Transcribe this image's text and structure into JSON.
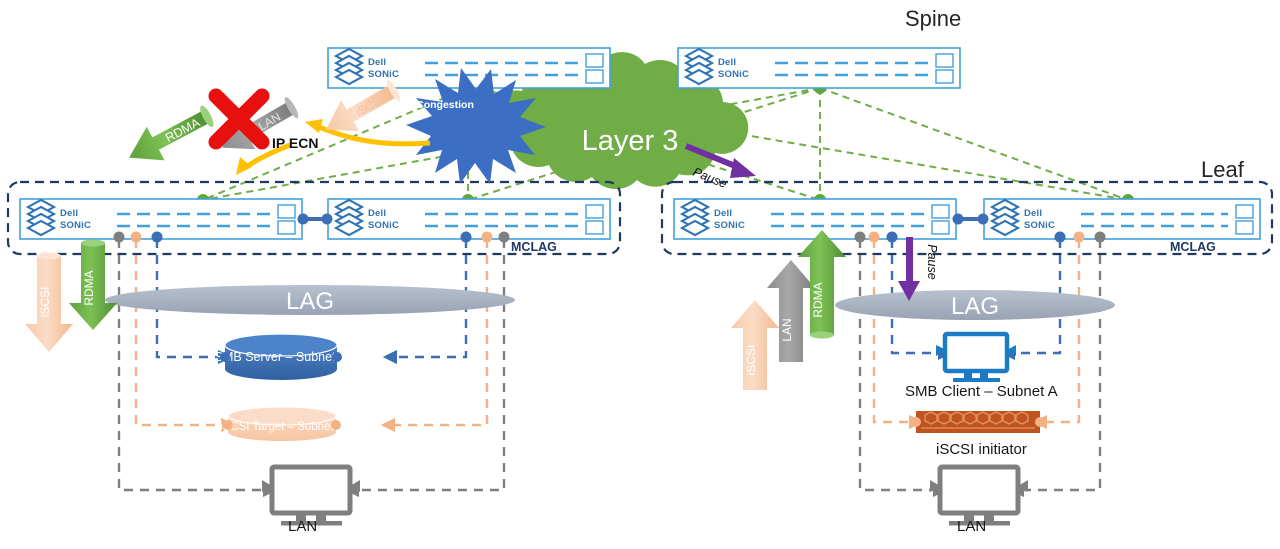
{
  "diagram": {
    "title_spine": "Spine",
    "title_leaf": "Leaf",
    "cloud_label": "Layer 3",
    "congestion_label": "Congestion",
    "ip_ecn_label": "IP ECN"
  },
  "colors": {
    "dell_blue": "#2e74b5",
    "switch_border": "#41a0dc",
    "leaf_box": "#1f3864",
    "cloud_green": "#70ad47",
    "rdma_green": "#5ea83c",
    "iscsi_peach": "#f8cbad",
    "lan_gray": "#808080",
    "pause_purple": "#7030a0",
    "congestion_blue": "#3c6fc4",
    "ecn_yellow": "#ffc000",
    "red_x": "#e8100f",
    "lag_gray": "#a6b1c2",
    "smb_blue": "#3b6eb5",
    "iscsi_init_orange": "#c0541f",
    "dot_gray": "#7f7f7f",
    "dot_peach": "#f4b183",
    "dot_blue": "#3b6eb5",
    "dot_green": "#5ea83c"
  },
  "switches": [
    {
      "id": "spine-1",
      "vendor": "Dell",
      "os": "SONiC",
      "role": "spine"
    },
    {
      "id": "spine-2",
      "vendor": "Dell",
      "os": "SONiC",
      "role": "spine"
    },
    {
      "id": "leaf-1",
      "vendor": "Dell",
      "os": "SONiC",
      "role": "leaf"
    },
    {
      "id": "leaf-2",
      "vendor": "Dell",
      "os": "SONiC",
      "role": "leaf"
    },
    {
      "id": "leaf-3",
      "vendor": "Dell",
      "os": "SONiC",
      "role": "leaf"
    },
    {
      "id": "leaf-4",
      "vendor": "Dell",
      "os": "SONiC",
      "role": "leaf"
    }
  ],
  "groups": {
    "left_mclag": "MCLAG",
    "right_mclag": "MCLAG",
    "left_lag": "LAG",
    "right_lag": "LAG"
  },
  "nodes": {
    "smb_server": "SMB Server – Subnet  B",
    "iscsi_target": "iSCSI Target – Subnet  A",
    "smb_client": "SMB Client – Subnet A",
    "iscsi_initiator": "iSCSI initiator",
    "lan_left": "LAN",
    "lan_right": "LAN"
  },
  "traffic_arrows": {
    "left_down": [
      {
        "label": "iSCSI",
        "color": "peach",
        "direction": "down"
      },
      {
        "label": "RDMA",
        "color": "green",
        "direction": "down"
      }
    ],
    "right_up": [
      {
        "label": "iSCSI",
        "color": "peach",
        "direction": "up"
      },
      {
        "label": "LAN",
        "color": "gray",
        "direction": "up"
      },
      {
        "label": "RDMA",
        "color": "green",
        "direction": "up"
      }
    ],
    "diagonal": [
      {
        "label": "RDMA",
        "color": "green",
        "direction": "down-left"
      },
      {
        "label": "LAN",
        "color": "gray",
        "direction": "down-left",
        "blocked": true
      },
      {
        "label": "iSCSI",
        "color": "peach",
        "direction": "down-left"
      }
    ],
    "pause": [
      {
        "label": "Pause",
        "color": "purple",
        "location": "cloud"
      },
      {
        "label": "Pause",
        "color": "purple",
        "location": "right-leaf"
      }
    ]
  }
}
